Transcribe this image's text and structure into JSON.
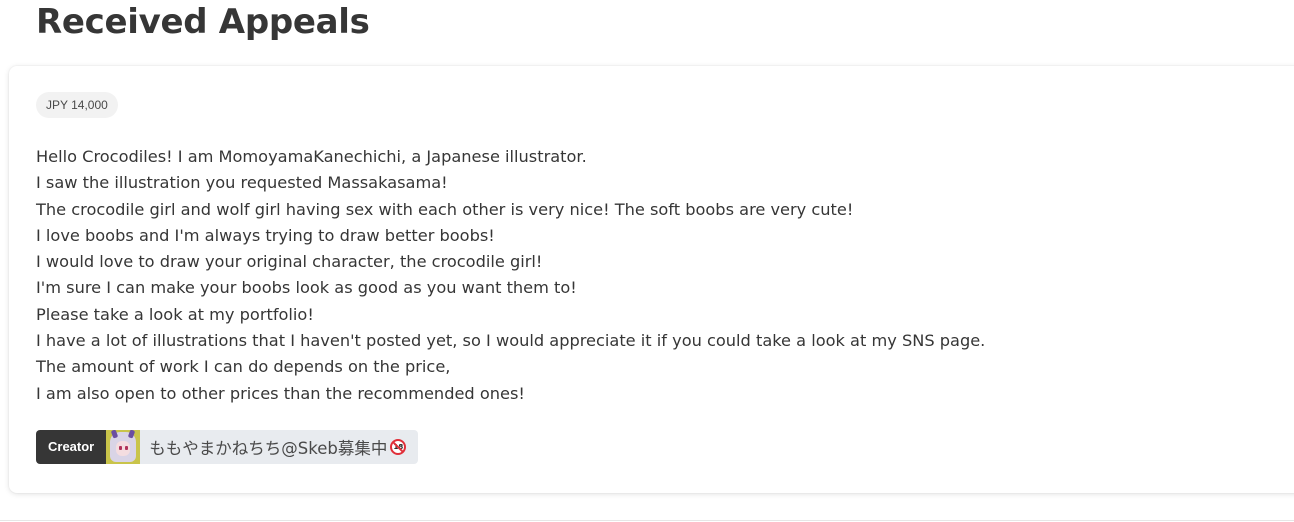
{
  "page": {
    "title": "Received Appeals"
  },
  "appeal": {
    "price": "JPY 14,000",
    "message_lines": [
      "Hello Crocodiles! I am MomoyamaKanechichi, a Japanese illustrator.",
      "I saw the illustration you requested Massakasama!",
      "The crocodile girl and wolf girl having sex with each other is very nice! The soft boobs are very cute!",
      "I love boobs and I'm always trying to draw better boobs!",
      "I would love to draw your original character, the crocodile girl!",
      "I'm sure I can make your boobs look as good as you want them to!",
      "Please take a look at my portfolio!",
      "I have a lot of illustrations that I haven't posted yet, so I would appreciate it if you could take a look at my SNS page.",
      "The amount of work I can do depends on the price,",
      "I am also open to other prices than the recommended ones!"
    ],
    "creator": {
      "tag_label": "Creator",
      "name": "ももやまかねちち@Skeb募集中",
      "badge_text": "18",
      "avatar_icon": "creator-avatar"
    }
  },
  "colors": {
    "text": "#363636",
    "tag_dark": "#363636",
    "tag_light": "#e8ebef",
    "price_bg": "#f2f2f2",
    "r18_red": "#e0303a"
  }
}
